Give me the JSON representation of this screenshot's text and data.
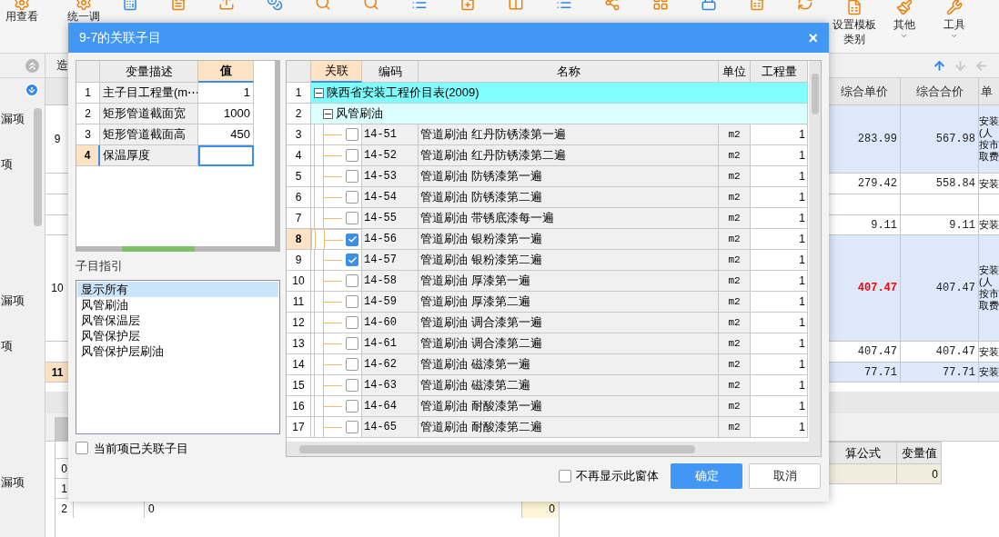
{
  "toolbar": {
    "left_buttons": [
      {
        "label": "用查看"
      },
      {
        "label": "统一调"
      }
    ],
    "right_buttons": [
      {
        "label": "设置模板类别",
        "caret": false
      },
      {
        "label": "其他",
        "caret": true
      },
      {
        "label": "工具",
        "caret": true
      }
    ]
  },
  "sidebar": {
    "items": [
      {
        "label": "漏项"
      },
      {
        "label": "项"
      },
      {
        "label": "漏项"
      },
      {
        "label": "项"
      },
      {
        "label": "漏项"
      }
    ]
  },
  "main_table": {
    "tab": "造",
    "columns": [
      "综合单价",
      "综合合价",
      "单"
    ],
    "rows": [
      {
        "number": "9",
        "shaded": true,
        "selected": false,
        "unit_price": "283.99",
        "total": "567.98",
        "note": "安装(人按市取费",
        "emphasis": false
      },
      {
        "shaded": false,
        "selected": false,
        "unit_price": "279.42",
        "total": "558.84",
        "note": "安装",
        "emphasis": false
      },
      {
        "shaded": false,
        "selected": false
      },
      {
        "shaded": false,
        "selected": false,
        "unit_price": "9.11",
        "total": "9.11",
        "note": "安装",
        "emphasis": false
      },
      {
        "number": "10",
        "shaded": true,
        "selected": false,
        "unit_price": "407.47",
        "total": "407.47",
        "note": "安装(人按市取费",
        "emphasis": true
      },
      {
        "shaded": false,
        "selected": false,
        "unit_price": "407.47",
        "total": "407.47",
        "note": "安装",
        "emphasis": false
      },
      {
        "number": "11",
        "shaded": true,
        "selected": true,
        "unit_price": "77.71",
        "total": "77.71",
        "note": "安装",
        "emphasis": false
      }
    ]
  },
  "bottom_grid": {
    "rows": [
      {
        "number": "0"
      },
      {
        "number": "1"
      },
      {
        "number": "2",
        "column_2": "0",
        "column_4": "0"
      }
    ]
  },
  "variable_grid": {
    "columns": [
      "算公式",
      "变量值"
    ],
    "rows": [
      {
        "value": "0"
      }
    ]
  },
  "dialog": {
    "title": "9-7的关联子目",
    "close": "×",
    "variables": {
      "columns": [
        "变量描述",
        "值"
      ],
      "rows": [
        {
          "number": "1",
          "description": "主子目工程量(m⋯",
          "value": "1",
          "selected": false
        },
        {
          "number": "2",
          "description": "矩形管道截面宽",
          "value": "1000",
          "selected": false
        },
        {
          "number": "3",
          "description": "矩形管道截面高",
          "value": "450",
          "selected": false
        },
        {
          "number": "4",
          "description": "保温厚度",
          "selected": true
        }
      ]
    },
    "guide": {
      "label": "子目指引",
      "items": [
        {
          "label": "显示所有",
          "selected": true
        },
        {
          "label": "风管刷油",
          "selected": false
        },
        {
          "label": "风管保温层",
          "selected": false
        },
        {
          "label": "风管保护层",
          "selected": false
        },
        {
          "label": "风管保护层刷油",
          "selected": false
        }
      ]
    },
    "linked_only": {
      "label": "当前项已关联子目",
      "checked": false
    },
    "items": {
      "columns": [
        "关联",
        "编码",
        "名称",
        "单位",
        "工程量"
      ],
      "tree": [
        {
          "number": "1",
          "label": "陕西省安装工程价目表(2009)",
          "expanded": true,
          "children": [
            {
              "number": "2",
              "label": "风管刷油",
              "expanded": true,
              "children": [
                {
                  "number": "3",
                  "code": "14-51",
                  "name": "管道刷油 红丹防锈漆第一遍",
                  "unit": "m2",
                  "quantity": "1",
                  "checked": false,
                  "selected": false
                },
                {
                  "number": "4",
                  "code": "14-52",
                  "name": "管道刷油 红丹防锈漆第二遍",
                  "unit": "m2",
                  "quantity": "1",
                  "checked": false,
                  "selected": false
                },
                {
                  "number": "5",
                  "code": "14-53",
                  "name": "管道刷油 防锈漆第一遍",
                  "unit": "m2",
                  "quantity": "1",
                  "checked": false,
                  "selected": false
                },
                {
                  "number": "6",
                  "code": "14-54",
                  "name": "管道刷油 防锈漆第二遍",
                  "unit": "m2",
                  "quantity": "1",
                  "checked": false,
                  "selected": false
                },
                {
                  "number": "7",
                  "code": "14-55",
                  "name": "管道刷油 带锈底漆每一遍",
                  "unit": "m2",
                  "quantity": "1",
                  "checked": false,
                  "selected": false
                },
                {
                  "number": "8",
                  "code": "14-56",
                  "name": "管道刷油 银粉漆第一遍",
                  "unit": "m2",
                  "quantity": "1",
                  "checked": true,
                  "selected": true
                },
                {
                  "number": "9",
                  "code": "14-57",
                  "name": "管道刷油 银粉漆第二遍",
                  "unit": "m2",
                  "quantity": "1",
                  "checked": true,
                  "selected": false
                },
                {
                  "number": "10",
                  "code": "14-58",
                  "name": "管道刷油 厚漆第一遍",
                  "unit": "m2",
                  "quantity": "1",
                  "checked": false,
                  "selected": false
                },
                {
                  "number": "11",
                  "code": "14-59",
                  "name": "管道刷油 厚漆第二遍",
                  "unit": "m2",
                  "quantity": "1",
                  "checked": false,
                  "selected": false
                },
                {
                  "number": "12",
                  "code": "14-60",
                  "name": "管道刷油 调合漆第一遍",
                  "unit": "m2",
                  "quantity": "1",
                  "checked": false,
                  "selected": false
                },
                {
                  "number": "13",
                  "code": "14-61",
                  "name": "管道刷油 调合漆第二遍",
                  "unit": "m2",
                  "quantity": "1",
                  "checked": false,
                  "selected": false
                },
                {
                  "number": "14",
                  "code": "14-62",
                  "name": "管道刷油 磁漆第一遍",
                  "unit": "m2",
                  "quantity": "1",
                  "checked": false,
                  "selected": false
                },
                {
                  "number": "15",
                  "code": "14-63",
                  "name": "管道刷油 磁漆第二遍",
                  "unit": "m2",
                  "quantity": "1",
                  "checked": false,
                  "selected": false
                },
                {
                  "number": "16",
                  "code": "14-64",
                  "name": "管道刷油 耐酸漆第一遍",
                  "unit": "m2",
                  "quantity": "1",
                  "checked": false,
                  "selected": false
                },
                {
                  "number": "17",
                  "code": "14-65",
                  "name": "管道刷油 耐酸漆第二遍",
                  "unit": "m2",
                  "quantity": "1",
                  "checked": false,
                  "selected": false
                }
              ]
            }
          ]
        }
      ]
    },
    "dont_show": {
      "label": "不再显示此窗体",
      "checked": false
    },
    "buttons": [
      {
        "label": "确定",
        "kind": "primary"
      },
      {
        "label": "取消",
        "kind": "secondary"
      }
    ]
  }
}
